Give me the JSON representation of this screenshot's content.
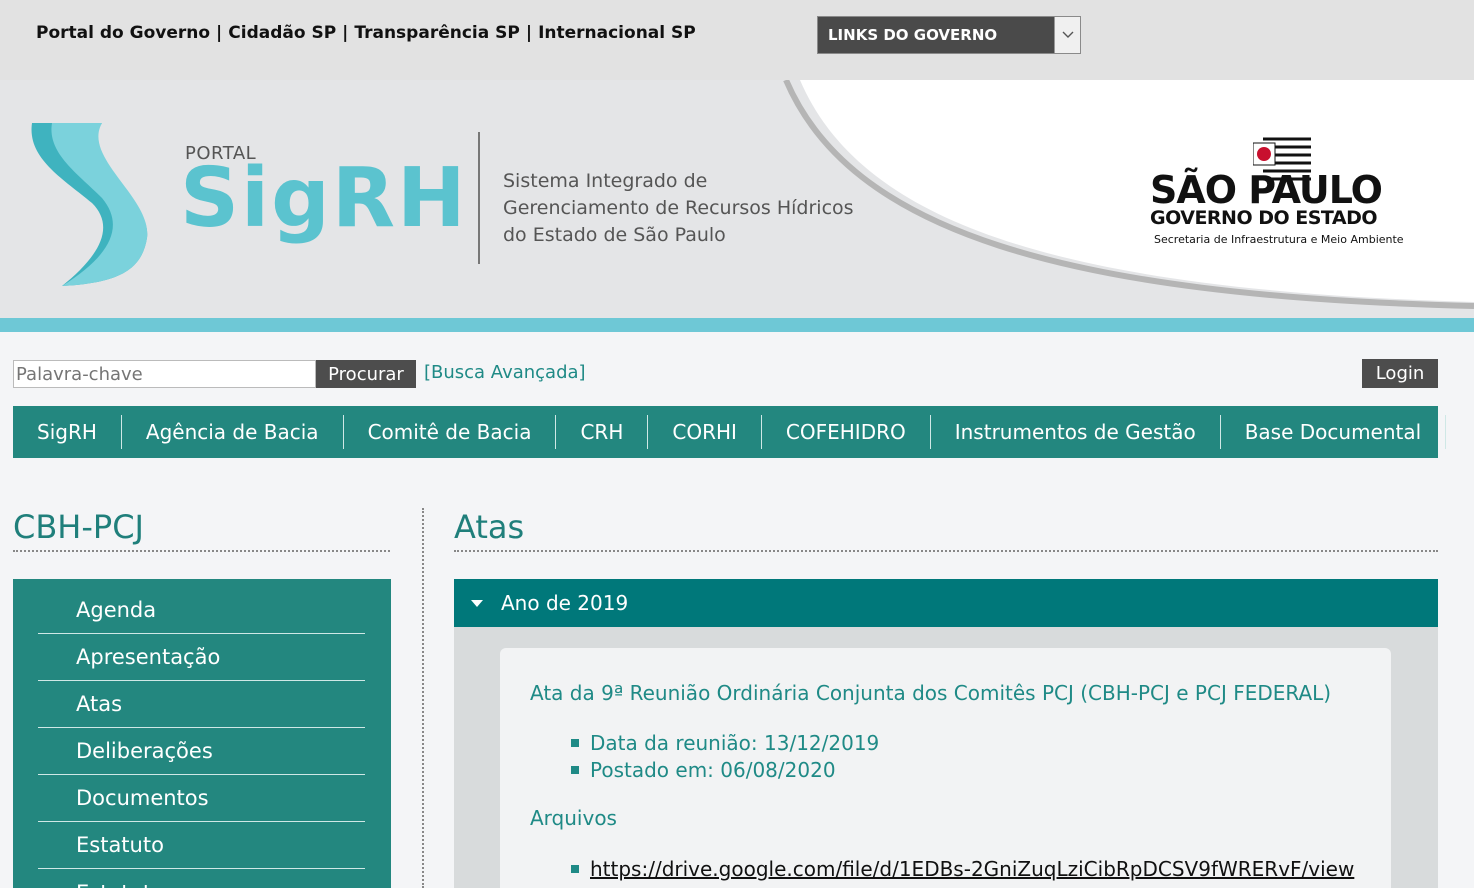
{
  "gov_bar": {
    "links": [
      "Portal do Governo",
      "Cidadão SP",
      "Transparência SP",
      "Internacional SP"
    ],
    "separator": "|",
    "select_label": "LINKS DO GOVERNO"
  },
  "banner": {
    "portal_label": "PORTAL",
    "brand": "SigRH",
    "system_name": [
      "Sistema Integrado de",
      "Gerenciamento  de Recursos Hídricos",
      "do Estado de São Paulo"
    ],
    "gov_logo": {
      "title": "SÃO PAULO",
      "subtitle": "GOVERNO DO ESTADO",
      "secretariat": "Secretaria de Infraestrutura e Meio Ambiente"
    },
    "colors": {
      "teal": "#5bc3cf",
      "stripe": "#6ec8d6"
    }
  },
  "search": {
    "placeholder": "Palavra-chave",
    "button": "Procurar",
    "advanced": "[Busca Avançada]"
  },
  "login": "Login",
  "main_nav": [
    "SigRH",
    "Agência de Bacia",
    "Comitê de Bacia",
    "CRH",
    "CORHI",
    "COFEHIDRO",
    "Instrumentos de Gestão",
    "Base Documental"
  ],
  "sidebar": {
    "title": "CBH-PCJ",
    "items": [
      "Agenda",
      "Apresentação",
      "Atas",
      "Deliberações",
      "Documentos",
      "Estatuto",
      "Estatuto"
    ]
  },
  "content": {
    "title": "Atas",
    "accordion_label": "Ano de 2019",
    "entry": {
      "title": "Ata da 9ª Reunião Ordinária Conjunta dos Comitês PCJ (CBH-PCJ e PCJ FEDERAL)",
      "meeting_date": "Data da reunião: 13/12/2019",
      "posted": "Postado em: 06/08/2020",
      "files_heading": "Arquivos",
      "file_link": "https://drive.google.com/file/d/1EDBs-2GniZuqLziCibRpDCSV9fWRERvF/view"
    }
  },
  "theme": {
    "primary": "#23877f",
    "accordion": "#00787a",
    "text_teal": "#1f8a86",
    "dark_button": "#4d4d4d"
  }
}
